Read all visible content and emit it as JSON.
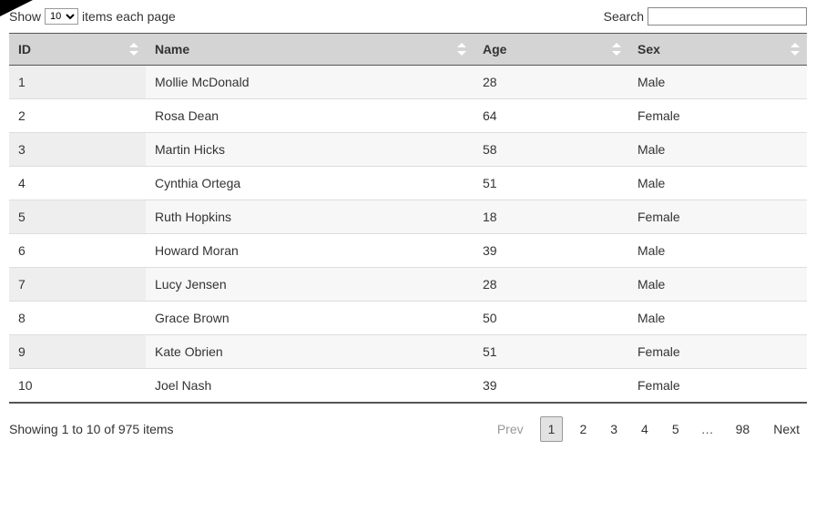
{
  "topbar": {
    "show_prefix": "Show",
    "page_size_selected": "10",
    "show_suffix": "items each page",
    "search_label": "Search"
  },
  "columns": {
    "id": "ID",
    "name": "Name",
    "age": "Age",
    "sex": "Sex"
  },
  "rows": [
    {
      "id": "1",
      "name": "Mollie McDonald",
      "age": "28",
      "sex": "Male"
    },
    {
      "id": "2",
      "name": "Rosa Dean",
      "age": "64",
      "sex": "Female"
    },
    {
      "id": "3",
      "name": "Martin Hicks",
      "age": "58",
      "sex": "Male"
    },
    {
      "id": "4",
      "name": "Cynthia Ortega",
      "age": "51",
      "sex": "Male"
    },
    {
      "id": "5",
      "name": "Ruth Hopkins",
      "age": "18",
      "sex": "Female"
    },
    {
      "id": "6",
      "name": "Howard Moran",
      "age": "39",
      "sex": "Male"
    },
    {
      "id": "7",
      "name": "Lucy Jensen",
      "age": "28",
      "sex": "Male"
    },
    {
      "id": "8",
      "name": "Grace Brown",
      "age": "50",
      "sex": "Male"
    },
    {
      "id": "9",
      "name": "Kate Obrien",
      "age": "51",
      "sex": "Female"
    },
    {
      "id": "10",
      "name": "Joel Nash",
      "age": "39",
      "sex": "Female"
    }
  ],
  "footer": {
    "status": "Showing 1 to 10 of 975 items",
    "prev": "Prev",
    "next": "Next",
    "pages": [
      "1",
      "2",
      "3",
      "4",
      "5"
    ],
    "last": "98",
    "current": "1",
    "ellipsis": "…"
  }
}
